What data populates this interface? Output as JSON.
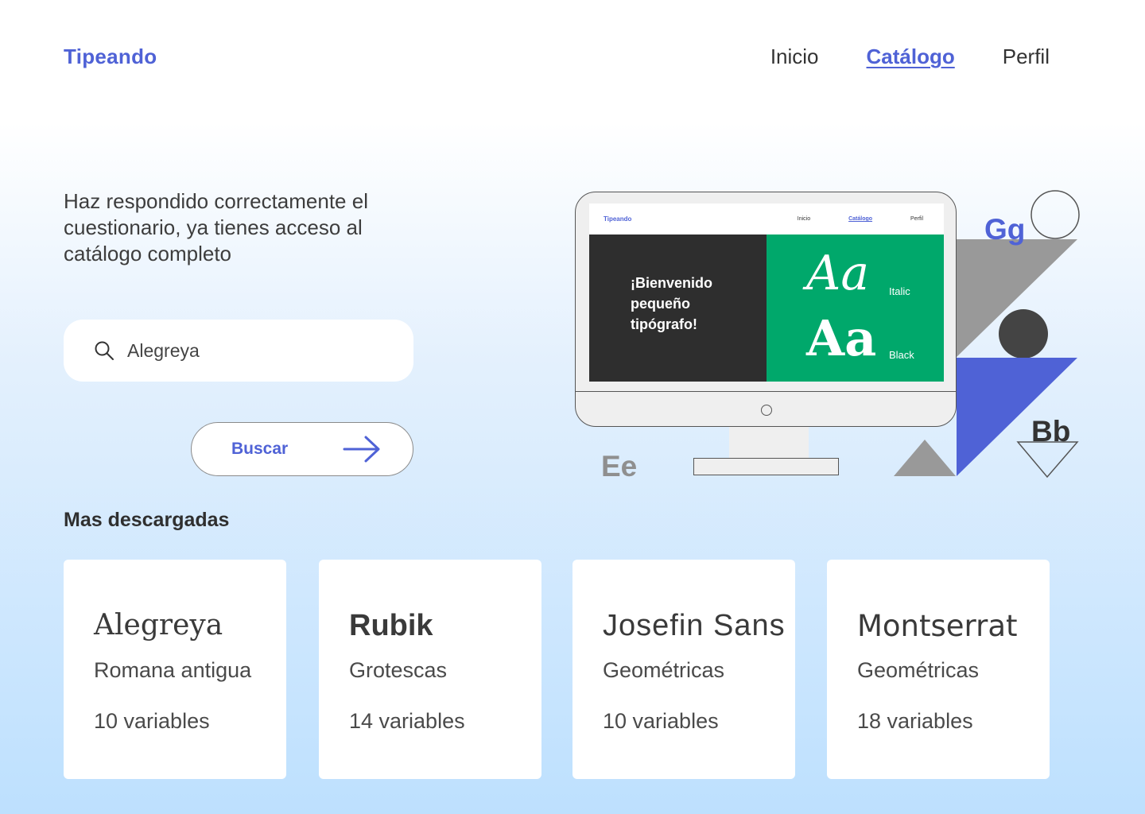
{
  "header": {
    "logo": "Tipeando",
    "nav": [
      {
        "label": "Inicio",
        "active": false
      },
      {
        "label": "Catálogo",
        "active": true
      },
      {
        "label": "Perfil",
        "active": false
      }
    ]
  },
  "hero": {
    "message": "Haz respondido correctamente el cuestionario, ya tienes acceso al catálogo completo",
    "search": {
      "value": "Alegreya",
      "icon": "search-icon"
    },
    "button_label": "Buscar",
    "button_icon": "arrow-right-icon"
  },
  "illustration": {
    "screen_logo": "Tipeando",
    "screen_nav": [
      "Inicio",
      "Catálogo",
      "Perfil"
    ],
    "welcome": "¡Bienvenido pequeño tipógrafo!",
    "sample_italic": "Aa",
    "label_italic": "Italic",
    "sample_black": "Aa",
    "label_black": "Black",
    "letters": {
      "gg": "Gg",
      "ee": "Ee",
      "bb": "Bb"
    },
    "colors": {
      "blue": "#4f62d6",
      "green": "#00a86b",
      "dark": "#2e2e2e",
      "gray": "#999999"
    }
  },
  "downloads": {
    "title": "Mas descargadas",
    "cards": [
      {
        "name": "Alegreya",
        "category": "Romana antigua",
        "variables": "10 variables"
      },
      {
        "name": "Rubik",
        "category": "Grotescas",
        "variables": "14 variables"
      },
      {
        "name": "Josefin Sans",
        "category": "Geométricas",
        "variables": "10 variables"
      },
      {
        "name": "Montserrat",
        "category": "Geométricas",
        "variables": "18 variables"
      }
    ]
  }
}
